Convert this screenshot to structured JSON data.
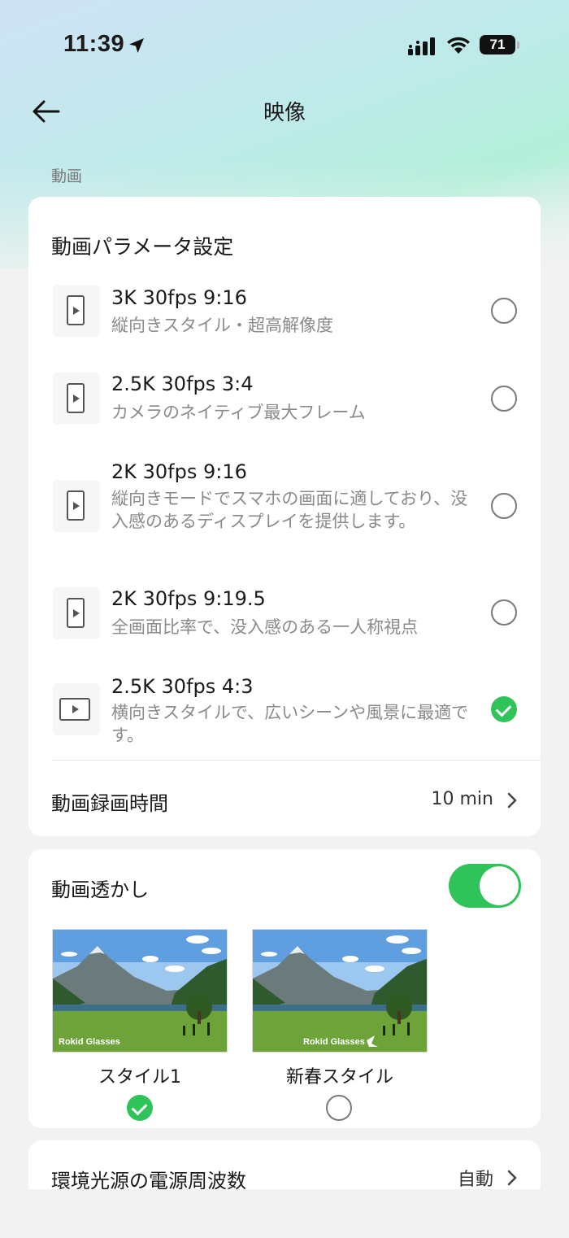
{
  "status_bar": {
    "time": "11:39",
    "battery": "71"
  },
  "header": {
    "title": "映像"
  },
  "section": {
    "label": "動画"
  },
  "video_params": {
    "heading": "動画パラメータ設定",
    "options": [
      {
        "title": "3K  30fps  9:16",
        "desc": "縦向きスタイル・超高解像度",
        "orientation": "portrait",
        "selected": false
      },
      {
        "title": "2.5K  30fps  3:4",
        "desc": "カメラのネイティブ最大フレーム",
        "orientation": "portrait",
        "selected": false
      },
      {
        "title": "2K  30fps  9:16",
        "desc": "縦向きモードでスマホの画面に適しており、没入感のあるディスプレイを提供します。",
        "orientation": "portrait",
        "selected": false
      },
      {
        "title": "2K  30fps  9:19.5",
        "desc": "全画面比率で、没入感のある一人称視点",
        "orientation": "portrait",
        "selected": false
      },
      {
        "title": "2.5K  30fps  4:3",
        "desc": "横向きスタイルで、広いシーンや風景に最適です。",
        "orientation": "landscape",
        "selected": true
      }
    ],
    "duration_label": "動画録画時間",
    "duration_value": "10 min"
  },
  "watermark": {
    "label": "動画透かし",
    "enabled": true,
    "styles": [
      {
        "label": "スタイル1",
        "watermark_text": "Rokid Glasses",
        "selected": true
      },
      {
        "label": "新春スタイル",
        "watermark_text": "Rokid Glasses",
        "selected": false
      }
    ]
  },
  "light_frequency": {
    "label": "環境光源の電源周波数",
    "value": "自動"
  },
  "colors": {
    "accent_green": "#2fc35a",
    "secondary_text": "#8a8a8a"
  }
}
